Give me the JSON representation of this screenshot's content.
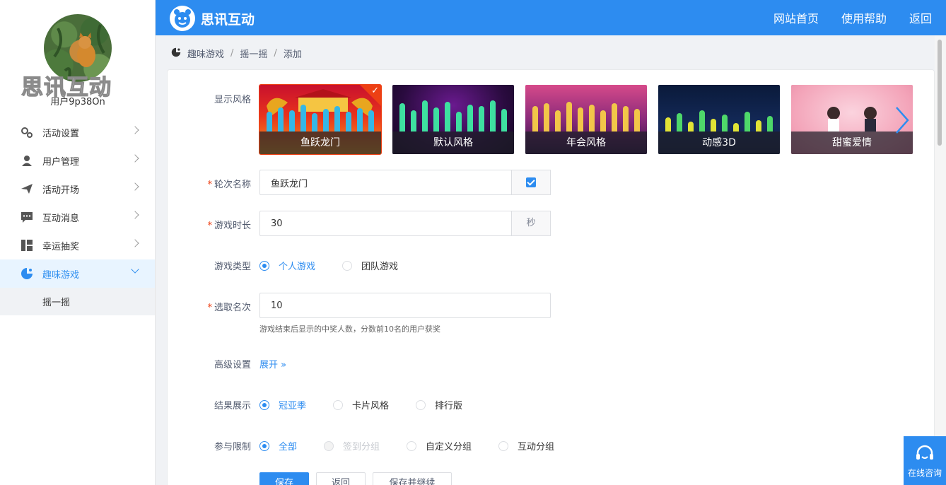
{
  "sidebar": {
    "brand_text": "思讯互动",
    "user_name": "用户9p38On",
    "items": [
      {
        "label": "活动设置",
        "icon": "gears-icon"
      },
      {
        "label": "用户管理",
        "icon": "user-icon"
      },
      {
        "label": "活动开场",
        "icon": "paper-plane-icon"
      },
      {
        "label": "互动消息",
        "icon": "chat-icon"
      },
      {
        "label": "幸运抽奖",
        "icon": "lottery-icon"
      },
      {
        "label": "趣味游戏",
        "icon": "game-icon",
        "active": true
      }
    ],
    "sub_item": "摇一摇"
  },
  "header": {
    "brand": "思讯互动",
    "nav": [
      "网站首页",
      "使用帮助",
      "返回"
    ]
  },
  "breadcrumb": [
    "趣味游戏",
    "摇一摇",
    "添加"
  ],
  "form": {
    "display_style_label": "显示风格",
    "styles": [
      {
        "name": "鱼跃龙门",
        "selected": true
      },
      {
        "name": "默认风格"
      },
      {
        "name": "年会风格"
      },
      {
        "name": "动感3D"
      },
      {
        "name": "甜蜜爱情"
      }
    ],
    "round_name_label": "轮次名称",
    "round_name_value": "鱼跃龙门",
    "duration_label": "游戏时长",
    "duration_value": "30",
    "duration_unit": "秒",
    "game_type_label": "游戏类型",
    "game_types": [
      "个人游戏",
      "团队游戏"
    ],
    "rank_label": "选取名次",
    "rank_value": "10",
    "rank_help": "游戏结束后显示的中奖人数，分数前10名的用户获奖",
    "advanced_label": "高级设置",
    "expand_label": "展开",
    "result_label": "结果展示",
    "results": [
      "冠亚季",
      "卡片风格",
      "排行版"
    ],
    "limit_label": "参与限制",
    "limits": [
      "全部",
      "签到分组",
      "自定义分组",
      "互动分组"
    ],
    "buttons": [
      "保存",
      "返回",
      "保存并继续"
    ]
  },
  "consult_label": "在线咨询",
  "colors": {
    "primary": "#2d8cf0",
    "required": "#ed4014"
  }
}
